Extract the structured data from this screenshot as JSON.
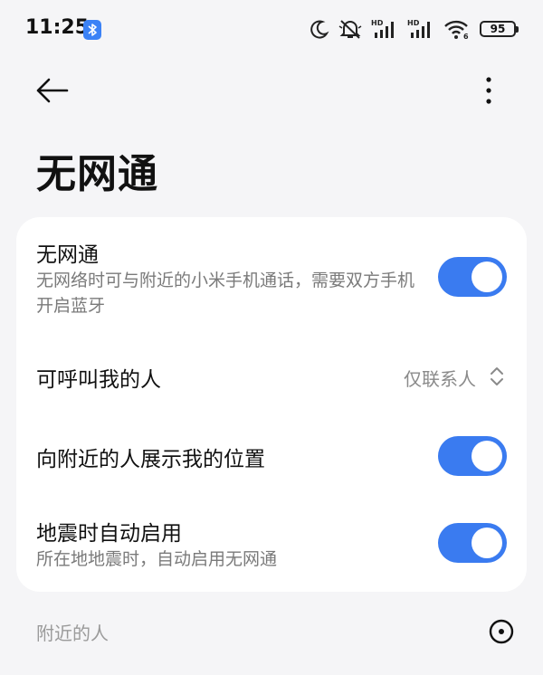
{
  "status_bar": {
    "time": "11:25",
    "battery": "95",
    "icons": [
      "bluetooth-icon",
      "moon-icon",
      "muted-bell-icon",
      "hd-signal-icon",
      "hd-signal-icon",
      "wifi-icon",
      "battery-icon"
    ]
  },
  "header": {
    "title": "无网通"
  },
  "settings": {
    "wuwangtong": {
      "title": "无网通",
      "description": "无网络时可与附近的小米手机通话，需要双方手机开启蓝牙",
      "enabled": true
    },
    "callable_by": {
      "title": "可呼叫我的人",
      "value": "仅联系人"
    },
    "show_location": {
      "title": "向附近的人展示我的位置",
      "enabled": true
    },
    "earthquake_auto": {
      "title": "地震时自动启用",
      "description": "所在地地震时，自动启用无网通",
      "enabled": true
    }
  },
  "nearby": {
    "label": "附近的人"
  },
  "colors": {
    "accent": "#3a7bf0",
    "background": "#f5f5f7",
    "card": "#ffffff"
  }
}
